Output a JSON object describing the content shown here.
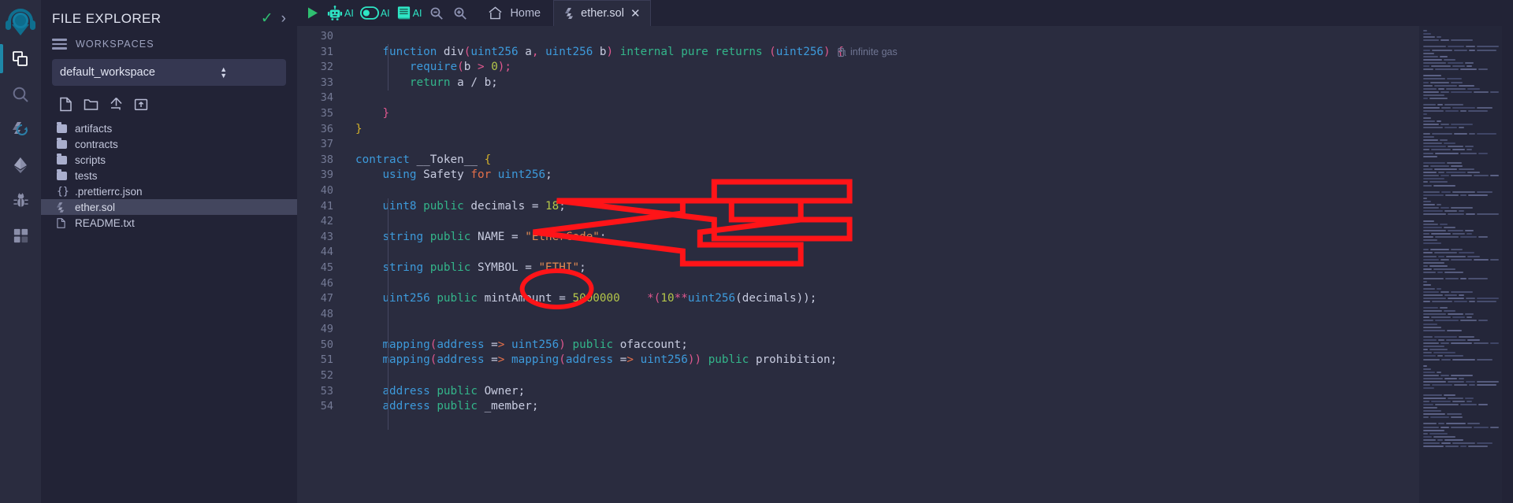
{
  "rail": {
    "items": [
      {
        "name": "remix-logo",
        "icon": "remix-logo-icon",
        "active": false
      },
      {
        "name": "file-explorer",
        "icon": "files-icon",
        "active": true
      },
      {
        "name": "search",
        "icon": "search-icon",
        "active": false
      },
      {
        "name": "solidity-compiler",
        "icon": "solidity-compiler-icon",
        "active": false
      },
      {
        "name": "deploy-run-transactions",
        "icon": "ethereum-icon",
        "active": false
      },
      {
        "name": "debugger",
        "icon": "bug-icon",
        "active": false
      },
      {
        "name": "plugin-manager",
        "icon": "plugin-icon",
        "active": false
      }
    ]
  },
  "explorer": {
    "title": "FILE EXPLORER",
    "check_icon": "check-icon",
    "collapse_icon": "chevron-right-icon",
    "workspaces_label": "WORKSPACES",
    "workspace_selected": "default_workspace",
    "tools": [
      {
        "name": "create-new-file",
        "icon": "new-file-icon"
      },
      {
        "name": "create-new-folder",
        "icon": "new-folder-icon"
      },
      {
        "name": "publish-to-gist",
        "icon": "upload-icon"
      },
      {
        "name": "upload-folder",
        "icon": "folder-upload-icon"
      }
    ],
    "tree": [
      {
        "label": "artifacts",
        "type": "folder",
        "selected": false
      },
      {
        "label": "contracts",
        "type": "folder",
        "selected": false
      },
      {
        "label": "scripts",
        "type": "folder",
        "selected": false
      },
      {
        "label": "tests",
        "type": "folder",
        "selected": false
      },
      {
        "label": ".prettierrc.json",
        "type": "json",
        "selected": false
      },
      {
        "label": "ether.sol",
        "type": "solidity",
        "selected": true
      },
      {
        "label": "README.txt",
        "type": "text",
        "selected": false
      }
    ]
  },
  "toolbar": {
    "run_icon": "play-run-icon",
    "items": [
      {
        "name": "remix-ai-assistant",
        "icon": "robot-icon",
        "label": "AI"
      },
      {
        "name": "ai-toggle",
        "icon": "toggle-icon",
        "label": "AI"
      },
      {
        "name": "ai-docs",
        "icon": "book-icon",
        "label": "AI"
      },
      {
        "name": "zoom-out",
        "icon": "zoom-out-icon",
        "label": ""
      },
      {
        "name": "zoom-in",
        "icon": "zoom-in-icon",
        "label": ""
      }
    ],
    "home_tab": {
      "label": "Home",
      "icon": "home-icon"
    },
    "file_tab": {
      "label": "ether.sol",
      "icon": "solidity-icon",
      "close_icon": "close-icon"
    }
  },
  "editor": {
    "first_line": 30,
    "gas_hint": "infinite gas",
    "gas_hint_icon": "gas-pump-icon",
    "lines": [
      {
        "n": 30,
        "tokens": []
      },
      {
        "n": 31,
        "tokens": [
          {
            "t": "    ",
            "c": "op"
          },
          {
            "t": "function",
            "c": "k"
          },
          {
            "t": " ",
            "c": "op"
          },
          {
            "t": "div",
            "c": "fn"
          },
          {
            "t": "(",
            "c": "punct"
          },
          {
            "t": "uint256",
            "c": "typ"
          },
          {
            "t": " a",
            "c": "id"
          },
          {
            "t": ",",
            "c": "punct"
          },
          {
            "t": " ",
            "c": "op"
          },
          {
            "t": "uint256",
            "c": "typ"
          },
          {
            "t": " b",
            "c": "id"
          },
          {
            "t": ")",
            "c": "punct"
          },
          {
            "t": " ",
            "c": "op"
          },
          {
            "t": "internal",
            "c": "k2"
          },
          {
            "t": " ",
            "c": "op"
          },
          {
            "t": "pure",
            "c": "k2"
          },
          {
            "t": " ",
            "c": "op"
          },
          {
            "t": "returns",
            "c": "k2"
          },
          {
            "t": " ",
            "c": "op"
          },
          {
            "t": "(",
            "c": "punct"
          },
          {
            "t": "uint256",
            "c": "typ"
          },
          {
            "t": ")",
            "c": "punct"
          },
          {
            "t": " ",
            "c": "op"
          },
          {
            "t": "{",
            "c": "punct"
          }
        ]
      },
      {
        "n": 32,
        "tokens": [
          {
            "t": "        ",
            "c": "op"
          },
          {
            "t": "require",
            "c": "typ"
          },
          {
            "t": "(",
            "c": "punct"
          },
          {
            "t": "b",
            "c": "id"
          },
          {
            "t": " > ",
            "c": "punct"
          },
          {
            "t": "0",
            "c": "num"
          },
          {
            "t": ")",
            "c": "punct"
          },
          {
            "t": ";",
            "c": "punct"
          }
        ]
      },
      {
        "n": 33,
        "tokens": [
          {
            "t": "        ",
            "c": "op"
          },
          {
            "t": "return",
            "c": "ret"
          },
          {
            "t": " a / b;",
            "c": "id"
          }
        ]
      },
      {
        "n": 34,
        "tokens": []
      },
      {
        "n": 35,
        "tokens": [
          {
            "t": "    ",
            "c": "op"
          },
          {
            "t": "}",
            "c": "punct"
          }
        ]
      },
      {
        "n": 36,
        "tokens": [
          {
            "t": "}",
            "c": "brace-y"
          }
        ]
      },
      {
        "n": 37,
        "tokens": []
      },
      {
        "n": 38,
        "tokens": [
          {
            "t": "contract",
            "c": "k"
          },
          {
            "t": " __Token__ ",
            "c": "id"
          },
          {
            "t": "{",
            "c": "brace-y"
          }
        ]
      },
      {
        "n": 39,
        "tokens": [
          {
            "t": "    ",
            "c": "op"
          },
          {
            "t": "using",
            "c": "k"
          },
          {
            "t": " Safety ",
            "c": "id"
          },
          {
            "t": "for",
            "c": "k3"
          },
          {
            "t": " ",
            "c": "op"
          },
          {
            "t": "uint256",
            "c": "typ"
          },
          {
            "t": ";",
            "c": "id"
          }
        ]
      },
      {
        "n": 40,
        "tokens": []
      },
      {
        "n": 41,
        "tokens": [
          {
            "t": "    ",
            "c": "op"
          },
          {
            "t": "uint8",
            "c": "typ"
          },
          {
            "t": " ",
            "c": "op"
          },
          {
            "t": "public",
            "c": "k2"
          },
          {
            "t": " decimals = ",
            "c": "id"
          },
          {
            "t": "18",
            "c": "num"
          },
          {
            "t": ";",
            "c": "id"
          }
        ]
      },
      {
        "n": 42,
        "tokens": []
      },
      {
        "n": 43,
        "tokens": [
          {
            "t": "    ",
            "c": "op"
          },
          {
            "t": "string",
            "c": "typ"
          },
          {
            "t": " ",
            "c": "op"
          },
          {
            "t": "public",
            "c": "k2"
          },
          {
            "t": " NAME = ",
            "c": "id"
          },
          {
            "t": "\"EtherCode\"",
            "c": "str"
          },
          {
            "t": ";",
            "c": "id"
          }
        ]
      },
      {
        "n": 44,
        "tokens": []
      },
      {
        "n": 45,
        "tokens": [
          {
            "t": "    ",
            "c": "op"
          },
          {
            "t": "string",
            "c": "typ"
          },
          {
            "t": " ",
            "c": "op"
          },
          {
            "t": "public",
            "c": "k2"
          },
          {
            "t": " SYMBOL = ",
            "c": "id"
          },
          {
            "t": "\"ETHI\"",
            "c": "str"
          },
          {
            "t": ";",
            "c": "id"
          }
        ]
      },
      {
        "n": 46,
        "tokens": []
      },
      {
        "n": 47,
        "tokens": [
          {
            "t": "    ",
            "c": "op"
          },
          {
            "t": "uint256",
            "c": "typ"
          },
          {
            "t": " ",
            "c": "op"
          },
          {
            "t": "public",
            "c": "k2"
          },
          {
            "t": " mintAmount = ",
            "c": "id"
          },
          {
            "t": "5000000",
            "c": "num"
          },
          {
            "t": "    *(",
            "c": "punct"
          },
          {
            "t": "10",
            "c": "num"
          },
          {
            "t": "**",
            "c": "punct"
          },
          {
            "t": "uint256",
            "c": "typ"
          },
          {
            "t": "(decimals));",
            "c": "id"
          }
        ]
      },
      {
        "n": 48,
        "tokens": []
      },
      {
        "n": 49,
        "tokens": []
      },
      {
        "n": 50,
        "tokens": [
          {
            "t": "    ",
            "c": "op"
          },
          {
            "t": "mapping",
            "c": "typ"
          },
          {
            "t": "(",
            "c": "punct"
          },
          {
            "t": "address",
            "c": "typ"
          },
          {
            "t": " =",
            "c": "id"
          },
          {
            "t": "> ",
            "c": "k3"
          },
          {
            "t": "uint256",
            "c": "typ"
          },
          {
            "t": ")",
            "c": "punct"
          },
          {
            "t": " ",
            "c": "op"
          },
          {
            "t": "public",
            "c": "k2"
          },
          {
            "t": " ofaccount;",
            "c": "id"
          }
        ]
      },
      {
        "n": 51,
        "tokens": [
          {
            "t": "    ",
            "c": "op"
          },
          {
            "t": "mapping",
            "c": "typ"
          },
          {
            "t": "(",
            "c": "punct"
          },
          {
            "t": "address",
            "c": "typ"
          },
          {
            "t": " =",
            "c": "id"
          },
          {
            "t": "> ",
            "c": "k3"
          },
          {
            "t": "mapping",
            "c": "typ"
          },
          {
            "t": "(",
            "c": "punct"
          },
          {
            "t": "address",
            "c": "typ"
          },
          {
            "t": " =",
            "c": "id"
          },
          {
            "t": "> ",
            "c": "k3"
          },
          {
            "t": "uint256",
            "c": "typ"
          },
          {
            "t": "))",
            "c": "punct"
          },
          {
            "t": " ",
            "c": "op"
          },
          {
            "t": "public",
            "c": "k2"
          },
          {
            "t": " prohibition;",
            "c": "id"
          }
        ]
      },
      {
        "n": 52,
        "tokens": []
      },
      {
        "n": 53,
        "tokens": [
          {
            "t": "    ",
            "c": "op"
          },
          {
            "t": "address",
            "c": "typ"
          },
          {
            "t": " ",
            "c": "op"
          },
          {
            "t": "public",
            "c": "k2"
          },
          {
            "t": " Owner;",
            "c": "id"
          }
        ]
      },
      {
        "n": 54,
        "tokens": [
          {
            "t": "    ",
            "c": "op"
          },
          {
            "t": "address",
            "c": "typ"
          },
          {
            "t": " ",
            "c": "op"
          },
          {
            "t": "public",
            "c": "k2"
          },
          {
            "t": " _member;",
            "c": "id"
          }
        ]
      }
    ]
  },
  "annotations": {
    "color": "#ff1418",
    "arrow_name_target": "NAME = \"EtherCode\";",
    "arrow_symbol_target": "SYMBOL = \"ETHI\";",
    "ellipse_target": "5000000"
  }
}
